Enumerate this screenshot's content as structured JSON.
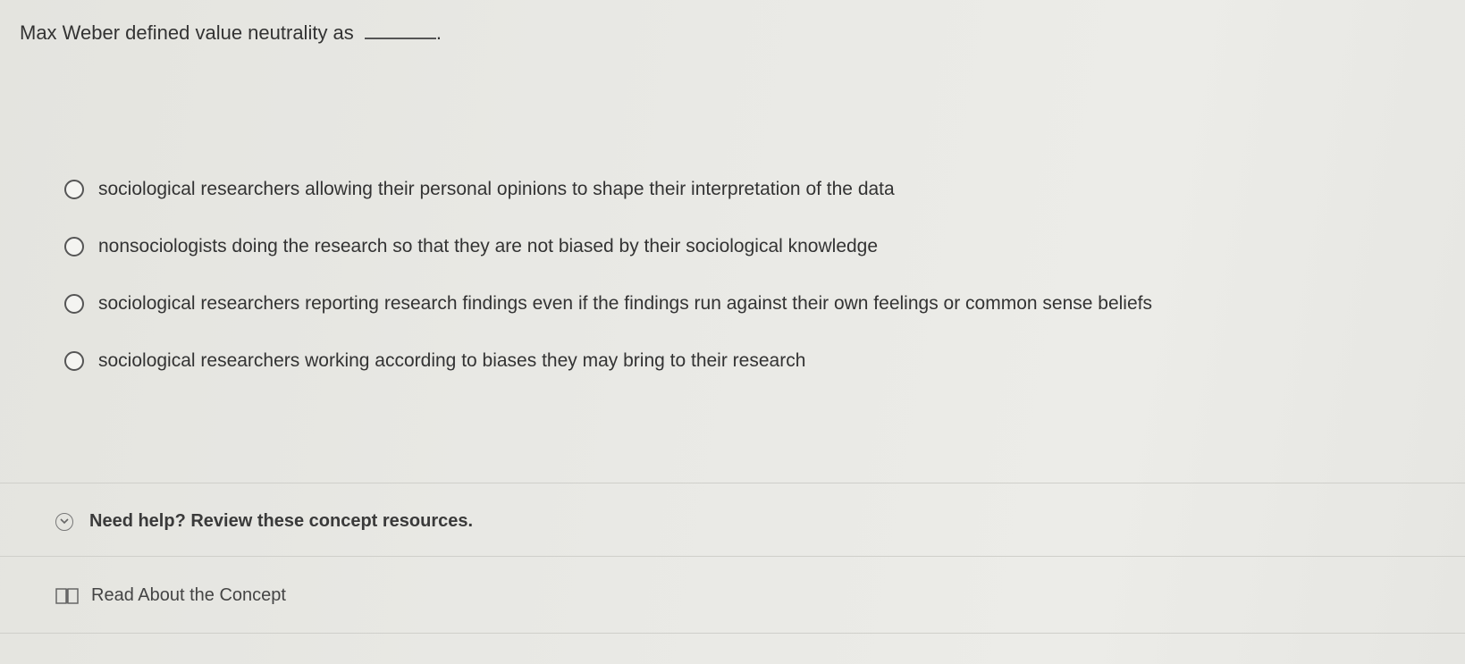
{
  "question": {
    "text": "Max Weber defined value neutrality as",
    "suffix": "."
  },
  "options": [
    {
      "label": "sociological researchers allowing their personal opinions to shape their interpretation of the data"
    },
    {
      "label": "nonsociologists doing the research so that they are not biased by their sociological knowledge"
    },
    {
      "label": "sociological researchers reporting research findings even if the findings run against their own feelings or common sense beliefs"
    },
    {
      "label": "sociological researchers working according to biases they may bring to their research"
    }
  ],
  "help": {
    "label": "Need help? Review these concept resources.",
    "icon": "chevron-down-circle-icon"
  },
  "resources": [
    {
      "label": "Read About the Concept",
      "icon": "book-icon"
    }
  ]
}
